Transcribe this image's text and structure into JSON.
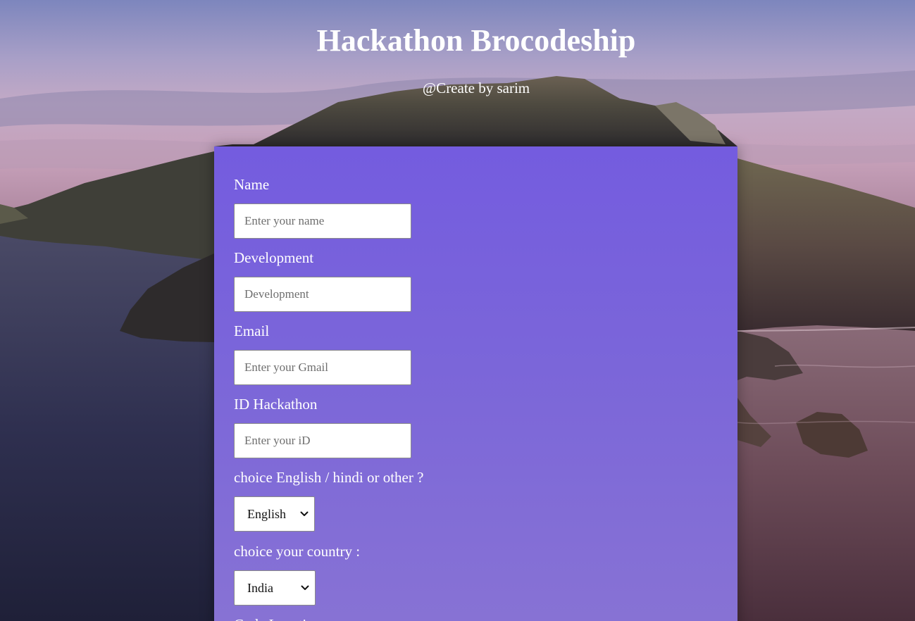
{
  "header": {
    "title": "Hackathon Brocodeship",
    "subtitle": "@Create by sarim"
  },
  "form": {
    "name": {
      "label": "Name",
      "placeholder": "Enter your name"
    },
    "development": {
      "label": "Development",
      "placeholder": "Development"
    },
    "email": {
      "label": "Email",
      "placeholder": "Enter your Gmail"
    },
    "hackathon_id": {
      "label": "ID Hackathon",
      "placeholder": "Enter your iD"
    },
    "language": {
      "label": "choice English / hindi or other ?",
      "selected": "English"
    },
    "country": {
      "label": "choice your country :",
      "selected": "India"
    },
    "next_label": {
      "label": "Code Location"
    }
  },
  "colors": {
    "panel": "#745cdf",
    "text": "#ffffff"
  },
  "icons": {
    "select_arrow": "chevron-down-icon"
  }
}
